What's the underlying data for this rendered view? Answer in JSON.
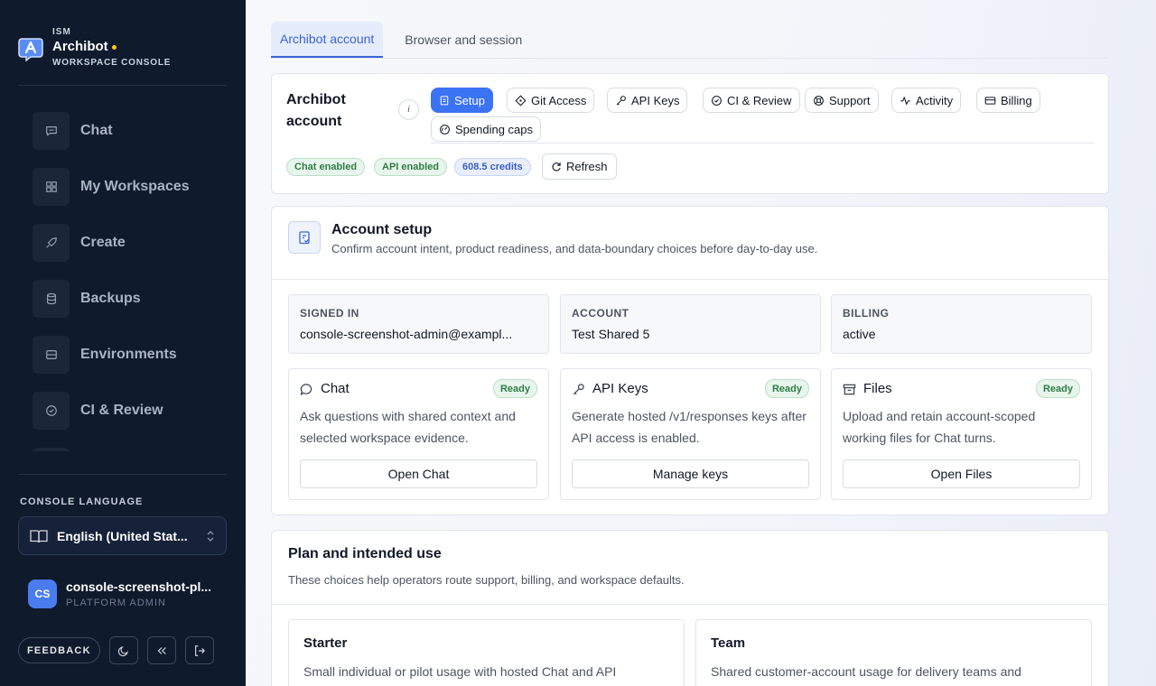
{
  "brand": {
    "small": "ISM",
    "name": "Archibot",
    "subtitle": "WORKSPACE CONSOLE",
    "dot_color": "#facc15"
  },
  "sidebar": {
    "items": [
      {
        "label": "Chat",
        "icon": "message-square-icon"
      },
      {
        "label": "My Workspaces",
        "icon": "grid-icon"
      },
      {
        "label": "Create",
        "icon": "rocket-icon"
      },
      {
        "label": "Backups",
        "icon": "database-icon"
      },
      {
        "label": "Environments",
        "icon": "server-icon"
      },
      {
        "label": "CI & Review",
        "icon": "check-circle-icon"
      }
    ],
    "language_title": "CONSOLE LANGUAGE",
    "language_value": "English (United Stat...",
    "user": {
      "initials": "CS",
      "name": "console-screenshot-pl...",
      "role": "PLATFORM ADMIN"
    },
    "feedback_label": "FEEDBACK"
  },
  "top_tabs": [
    {
      "label": "Archibot account",
      "active": true
    },
    {
      "label": "Browser and session",
      "active": false
    }
  ],
  "account_card": {
    "title": "Archibot account",
    "info_label": "i",
    "subtabs": [
      {
        "label": "Setup",
        "active": true
      },
      {
        "label": "Git Access"
      },
      {
        "label": "API Keys"
      },
      {
        "label": "CI & Review"
      },
      {
        "label": "Support"
      },
      {
        "label": "Activity"
      },
      {
        "label": "Billing"
      },
      {
        "label": "Spending caps"
      }
    ],
    "badges": [
      "Chat enabled",
      "API enabled",
      "608.5 credits"
    ],
    "refresh_label": "Refresh"
  },
  "setup": {
    "title": "Account setup",
    "description": "Confirm account intent, product readiness, and data-boundary choices before day-to-day use.",
    "info_boxes": [
      {
        "label": "SIGNED IN",
        "value": "console-screenshot-admin@exampl..."
      },
      {
        "label": "ACCOUNT",
        "value": "Test Shared 5"
      },
      {
        "label": "BILLING",
        "value": "active"
      }
    ],
    "features": [
      {
        "title": "Chat",
        "status": "Ready",
        "description": "Ask questions with shared context and selected workspace evidence.",
        "button": "Open Chat"
      },
      {
        "title": "API Keys",
        "status": "Ready",
        "description": "Generate hosted /v1/responses keys after API access is enabled.",
        "button": "Manage keys"
      },
      {
        "title": "Files",
        "status": "Ready",
        "description": "Upload and retain account-scoped working files for Chat turns.",
        "button": "Open Files"
      }
    ]
  },
  "plan": {
    "title": "Plan and intended use",
    "description": "These choices help operators route support, billing, and workspace defaults.",
    "options": [
      {
        "title": "Starter",
        "description": "Small individual or pilot usage with hosted Chat and API"
      },
      {
        "title": "Team",
        "description": "Shared customer-account usage for delivery teams and"
      }
    ]
  },
  "colors": {
    "accent": "#3b73f5",
    "sidebar_bg": "#0f1a2c",
    "ready_green": "#2f7d46"
  }
}
